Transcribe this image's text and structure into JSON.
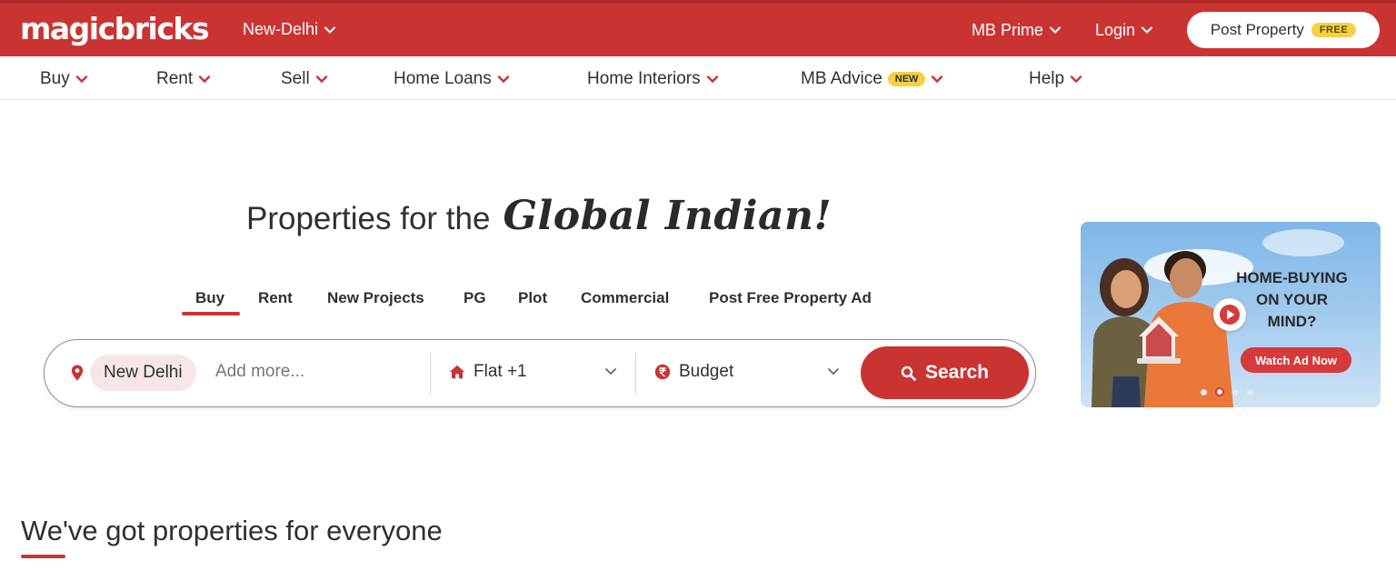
{
  "header": {
    "logo": "magicbricks",
    "city": "New-Delhi",
    "mb_prime": "MB Prime",
    "login": "Login",
    "post_property": "Post Property",
    "free_badge": "FREE"
  },
  "nav": {
    "items": [
      {
        "label": "Buy"
      },
      {
        "label": "Rent"
      },
      {
        "label": "Sell"
      },
      {
        "label": "Home Loans"
      },
      {
        "label": "Home Interiors"
      },
      {
        "label": "MB Advice",
        "badge": "NEW"
      },
      {
        "label": "Help"
      }
    ]
  },
  "hero": {
    "headline_plain": "Properties for the",
    "headline_script": "Global Indian!",
    "tabs": [
      {
        "label": "Buy",
        "active": true
      },
      {
        "label": "Rent"
      },
      {
        "label": "New Projects"
      },
      {
        "label": "PG"
      },
      {
        "label": "Plot"
      },
      {
        "label": "Commercial"
      },
      {
        "label": "Post Free Property Ad"
      }
    ]
  },
  "search": {
    "location_chip": "New Delhi",
    "add_more_placeholder": "Add more...",
    "property_type": "Flat +1",
    "budget": "Budget",
    "search_button": "Search"
  },
  "ad": {
    "line1": "HOME-BUYING",
    "line2": "ON YOUR",
    "line3": "MIND?",
    "cta": "Watch Ad Now",
    "slides_total": 4,
    "active_slide": 2
  },
  "section": {
    "title": "We've got properties for everyone"
  },
  "colors": {
    "brand_red": "#c93433",
    "badge_yellow": "#f7d043",
    "chip_bg": "#f6e7e6"
  }
}
